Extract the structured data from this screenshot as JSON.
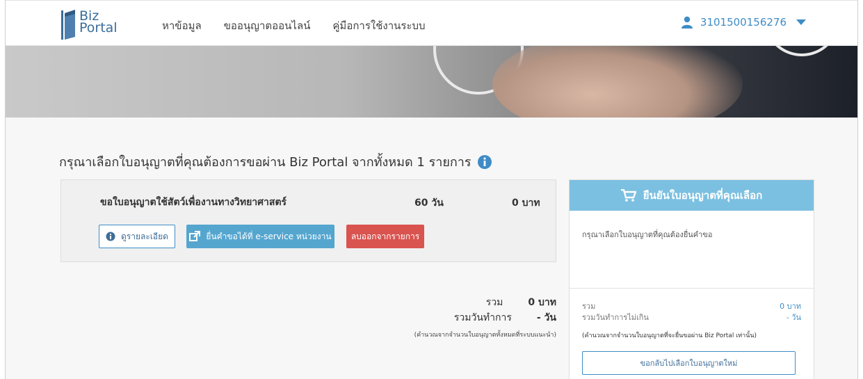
{
  "header": {
    "logo_line1": "Biz",
    "logo_line2": "Portal",
    "nav": [
      "หาข้อมูล",
      "ขออนุญาตออนไลน์",
      "คู่มือการใช้งานระบบ"
    ],
    "user_id": "3101500156276"
  },
  "main": {
    "title": "กรุณาเลือกใบอนุญาตที่คุณต้องการขอผ่าน Biz Portal จากทั้งหมด 1 รายการ",
    "license": {
      "name": "ขอใบอนุญาตใช้สัตว์เพื่องานทางวิทยาศาสตร์",
      "days": "60 วัน",
      "price": "0 บาท",
      "detail_label": "ดูรายละเอียด",
      "eservice_label": "ยื่นคำขอได้ที่ e-service หน่วยงาน",
      "remove_label": "ลบออกจากรายการ"
    },
    "totals": {
      "sum_label": "รวม",
      "sum_value": "0 บาท",
      "days_label": "รวมวันทำการ",
      "days_value": "- วัน",
      "note": "(คำนวณจากจำนวนใบอนุญาตทั้งหมดที่ระบบแนะนำ)"
    }
  },
  "panel": {
    "header": "ยืนยันใบอนุญาตที่คุณเลือก",
    "message": "กรุณาเลือกใบอนุญาตที่คุณต้องยื่นคำขอ",
    "sum_label": "รวม",
    "sum_value": "0 บาท",
    "days_label": "รวมวันทำการไม่เกิน",
    "days_value": "- วัน",
    "note": "(คำนวณจากจำนวนใบอนุญาตที่จะยื่นขอผ่าน Biz Portal เท่านั้น)",
    "back_label": "ขอกลับไปเลือกใบอนุญาตใหม่"
  },
  "colors": {
    "accent": "#3e8cc7",
    "panel_header": "#7cc0e1",
    "danger": "#d9534f",
    "eservice": "#55a6cf"
  }
}
